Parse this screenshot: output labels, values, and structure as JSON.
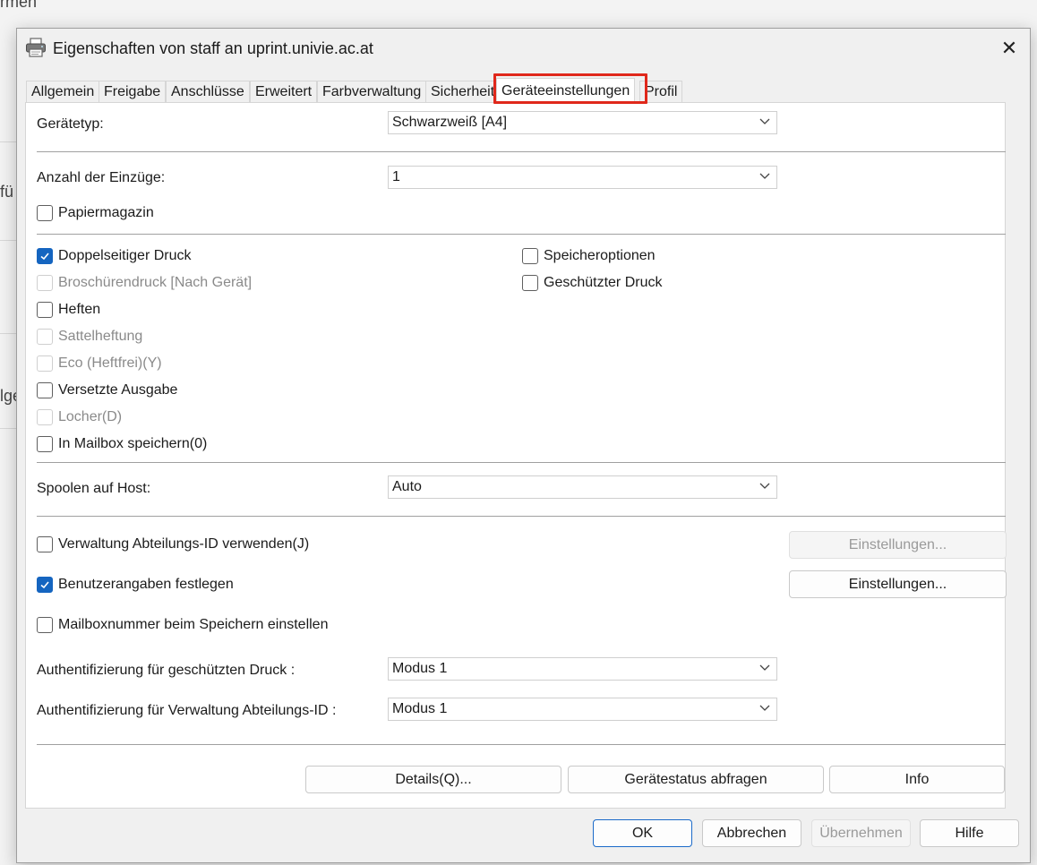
{
  "background": {
    "top_text": "rmen",
    "left_text_1": "fü",
    "left_text_2": "lge"
  },
  "window": {
    "title": "Eigenschaften von staff an uprint.univie.ac.at",
    "close_glyph": "✕"
  },
  "tabs": [
    {
      "label": "Allgemein"
    },
    {
      "label": "Freigabe"
    },
    {
      "label": "Anschlüsse"
    },
    {
      "label": "Erweitert"
    },
    {
      "label": "Farbverwaltung"
    },
    {
      "label": "Sicherheit"
    },
    {
      "label": "Geräteeinstellungen",
      "active": true
    },
    {
      "label": "Profil"
    }
  ],
  "fields": {
    "device_type": {
      "label": "Gerätetyp:",
      "value": "Schwarzweiß [A4]"
    },
    "num_feeders": {
      "label": "Anzahl der Einzüge:",
      "value": "1"
    },
    "spool_host": {
      "label": "Spoolen auf Host:",
      "value": "Auto"
    },
    "auth_secure": {
      "label": "Authentifizierung für geschützten Druck :",
      "value": "Modus 1"
    },
    "auth_dept": {
      "label": "Authentifizierung für Verwaltung Abteilungs-ID :",
      "value": "Modus 1"
    }
  },
  "checkboxes": {
    "papiermagazin": {
      "label": "Papiermagazin",
      "checked": false
    },
    "duplex": {
      "label": "Doppelseitiger Druck",
      "checked": true
    },
    "brochure": {
      "label": "Broschürendruck [Nach Gerät]",
      "checked": false,
      "disabled": true
    },
    "staple": {
      "label": "Heften",
      "checked": false
    },
    "saddle": {
      "label": "Sattelheftung",
      "checked": false,
      "disabled": true
    },
    "eco": {
      "label": "Eco (Heftfrei)(Y)",
      "checked": false,
      "disabled": true
    },
    "offset": {
      "label": "Versetzte Ausgabe",
      "checked": false
    },
    "punch": {
      "label": "Locher(D)",
      "checked": false,
      "disabled": true
    },
    "mailbox": {
      "label": "In Mailbox speichern(0)",
      "checked": false
    },
    "memory": {
      "label": "Speicheroptionen",
      "checked": false
    },
    "secure": {
      "label": "Geschützter Druck",
      "checked": false
    },
    "dept_id": {
      "label": "Verwaltung Abteilungs-ID verwenden(J)",
      "checked": false
    },
    "user_info": {
      "label": "Benutzerangaben festlegen",
      "checked": true
    },
    "mailbox_num": {
      "label": "Mailboxnummer beim Speichern einstellen",
      "checked": false
    }
  },
  "buttons": {
    "settings_dept": "Einstellungen...",
    "settings_user": "Einstellungen...",
    "details": "Details(Q)...",
    "device_status": "Gerätestatus abfragen",
    "info": "Info",
    "ok": "OK",
    "cancel": "Abbrechen",
    "apply": "Übernehmen",
    "help": "Hilfe"
  },
  "colors": {
    "accent": "#1565c0",
    "highlight": "#e0281b"
  }
}
